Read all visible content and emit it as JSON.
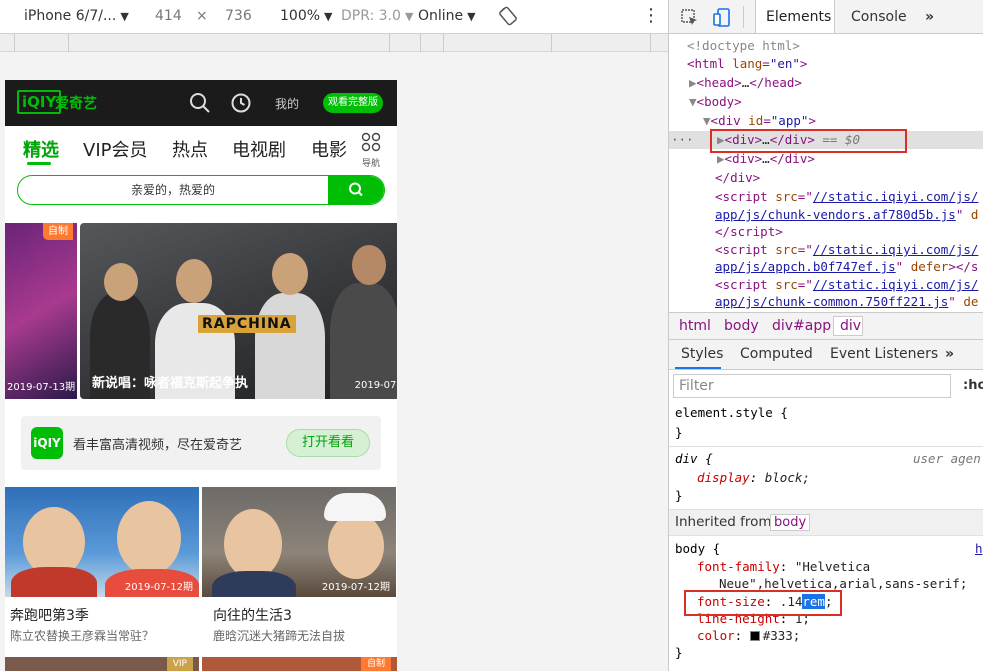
{
  "device_toolbar": {
    "device": "iPhone 6/7/...",
    "width": "414",
    "times": "×",
    "height": "736",
    "zoom": "100%",
    "dpr": "DPR: 3.0",
    "network": "Online",
    "more": "⋮"
  },
  "phone": {
    "header": {
      "logo_mark": "iQIY",
      "logo_text": "爱奇艺",
      "mine": "我的",
      "full_button": "观看完整版"
    },
    "nav": {
      "items": [
        "精选",
        "VIP会员",
        "热点",
        "电视剧",
        "电影"
      ],
      "more_label": "导航"
    },
    "search": {
      "placeholder": "亲爱的，热爱的"
    },
    "banner": {
      "left_tag": "自制",
      "left_date": "2019-07-13期",
      "logo": "RAPCHINA",
      "caption": "新说唱：咏者福克斯起争执",
      "date": "2019-07-"
    },
    "promo": {
      "logo": "iQIY",
      "text": "看丰富高清视频，尽在爱奇艺",
      "button": "打开看看"
    },
    "cards": [
      {
        "date": "2019-07-12期",
        "title": "奔跑吧第3季",
        "subtitle": "陈立农替换王彦霖当常驻？"
      },
      {
        "date": "2019-07-12期",
        "title": "向往的生活3",
        "subtitle": "鹿晗沉迷大猪蹄无法自拔"
      }
    ],
    "thumb_tags": [
      "VIP",
      "自制"
    ]
  },
  "devtools": {
    "tabs": [
      "Elements",
      "Console",
      "»"
    ],
    "dom": {
      "doctype": "<!doctype html>",
      "html_tag": "html",
      "lang_attr": "lang",
      "lang_val": "\"en\"",
      "head_tag": "head",
      "body_tag": "body",
      "div_tag": "div",
      "id_attr": "id",
      "id_val": "\"app\"",
      "ellipsis": "…",
      "eq": "== $0",
      "script_tag": "script",
      "src_attr": "src",
      "defer_attr": "defer",
      "script1_src_a": "//static.iqiyi.com/js/",
      "script1_src_b": "app/js/chunk-vendors.af780d5b.js",
      "script2_src_a": "//static.iqiyi.com/js/",
      "script2_src_b": "app/js/appch.b0f747ef.js",
      "script3_src_a": "//static.iqiyi.com/js/",
      "script3_src_b": "app/js/chunk-common.750ff221.js",
      "trail_d": "d",
      "trail_s": "</s",
      "trail_de": "de"
    },
    "breadcrumbs": [
      "html",
      "body",
      "div#app",
      "div"
    ],
    "style_tabs": [
      "Styles",
      "Computed",
      "Event Listeners",
      "»"
    ],
    "filter_placeholder": "Filter",
    "hov": ":ho",
    "styles": {
      "element_style": "element.style {",
      "close": "}",
      "div_selector": "div {",
      "user_agent": "user agen",
      "display_name": "display",
      "display_value": "block;",
      "inherited_label": "Inherited from",
      "inherited_tag": "body",
      "body_selector": "body {",
      "body_link": "h",
      "ff_name": "font-family",
      "ff_value_1": "\"Helvetica",
      "ff_value_2": "Neue\",helvetica,arial,sans-serif;",
      "fs_name": "font-size",
      "fs_value_pre": ".14",
      "fs_value_sel": "rem",
      "fs_value_post": ";",
      "lh_name": "line-height",
      "lh_value": "1;",
      "color_name": "color",
      "color_value": "#333;",
      "color_swatch": "#000000"
    }
  }
}
